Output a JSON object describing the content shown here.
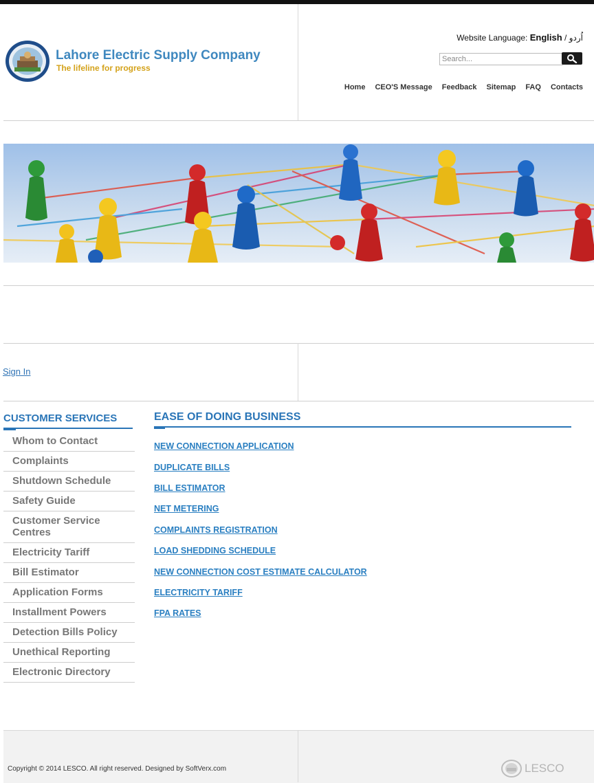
{
  "header": {
    "company_name": "Lahore Electric Supply Company",
    "tagline": "The lifeline for progress",
    "language_label": "Website Language:",
    "language_english": "English",
    "language_separator": "/",
    "language_urdu": "اُردو",
    "search_placeholder": "Search...",
    "nav": [
      "Home",
      "CEO'S Message",
      "Feedback",
      "Sitemap",
      "FAQ",
      "Contacts"
    ]
  },
  "sign_in": "Sign In",
  "customer_services": {
    "title": "CUSTOMER SERVICES",
    "items": [
      "Whom to Contact",
      "Complaints",
      "Shutdown Schedule",
      "Safety Guide",
      "Customer Service Centres",
      "Electricity Tariff",
      "Bill Estimator",
      "Application Forms",
      "Installment Powers",
      "Detection Bills Policy",
      "Unethical Reporting",
      "Electronic Directory"
    ]
  },
  "ease_of_doing_business": {
    "title": "EASE OF DOING BUSINESS",
    "links": [
      "NEW CONNECTION APPLICATION",
      "DUPLICATE BILLS",
      "BILL ESTIMATOR",
      "NET METERING",
      "COMPLAINTS REGISTRATION",
      "LOAD SHEDDING SCHEDULE",
      "NEW CONNECTION COST ESTIMATE CALCULATOR",
      "ELECTRICITY TARIFF",
      "FPA RATES"
    ]
  },
  "footer": {
    "copyright": "Copyright © 2014 LESCO. All right reserved. Designed by SoftVerx.com",
    "logo_text": "LESCO"
  },
  "colors": {
    "accent_blue": "#2a75b7",
    "brand_blue": "#3f88bf",
    "tagline_gold": "#d4a21a",
    "link_blue": "#2a7fc1"
  }
}
